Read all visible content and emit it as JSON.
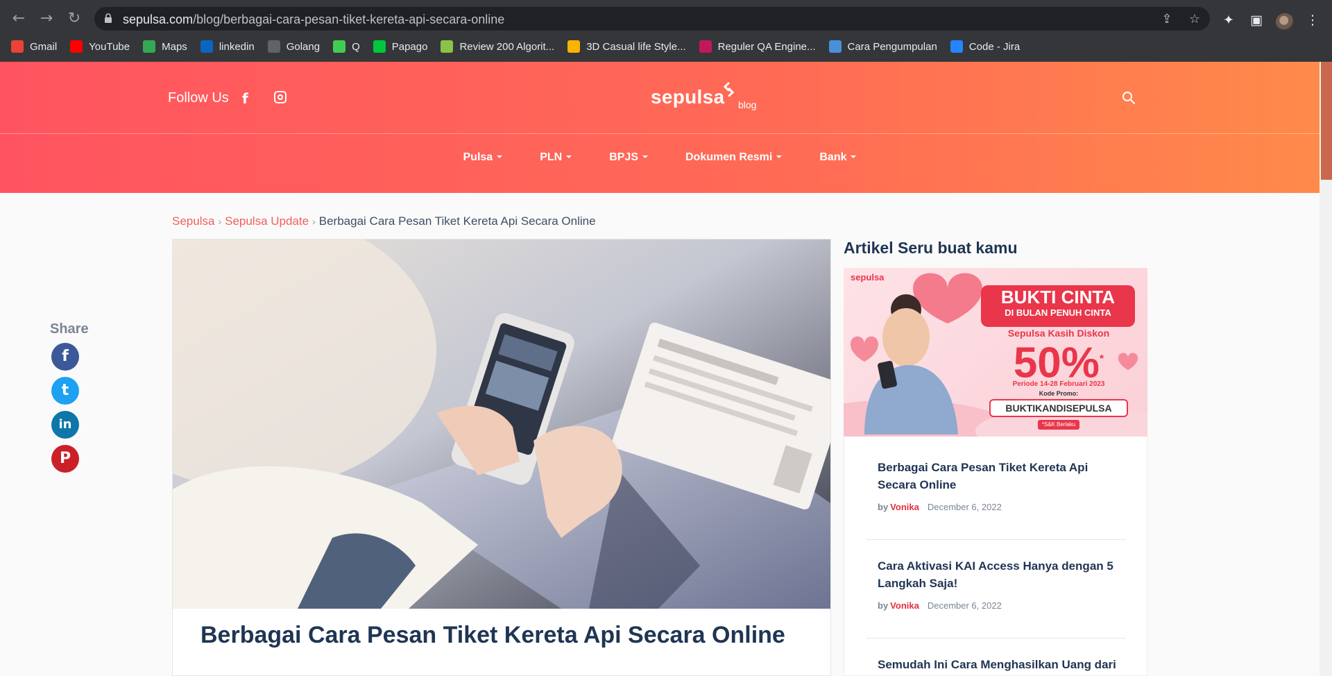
{
  "browser": {
    "url_host": "sepulsa.com",
    "url_path": "/blog/berbagai-cara-pesan-tiket-kereta-api-secara-online",
    "bookmarks": [
      {
        "label": "Gmail",
        "icon": "gmail-icon",
        "color": "#ea4335"
      },
      {
        "label": "YouTube",
        "icon": "youtube-icon",
        "color": "#ff0000"
      },
      {
        "label": "Maps",
        "icon": "maps-icon",
        "color": "#34a853"
      },
      {
        "label": "linkedin",
        "icon": "linkedin-icon",
        "color": "#0a66c2"
      },
      {
        "label": "Golang",
        "icon": "golang-icon",
        "color": "#5f6368"
      },
      {
        "label": "Q",
        "icon": "qt-icon",
        "color": "#41cd52"
      },
      {
        "label": "Papago",
        "icon": "papago-icon",
        "color": "#00c73c"
      },
      {
        "label": "Review 200 Algorit...",
        "icon": "pen-icon",
        "color": "#8bc34a"
      },
      {
        "label": "3D Casual life Style...",
        "icon": "o-icon",
        "color": "#f9b400"
      },
      {
        "label": "Reguler QA Engine...",
        "icon": "flask-icon",
        "color": "#c2185b"
      },
      {
        "label": "Cara Pengumpulan",
        "icon": "laptop-icon",
        "color": "#4a90d9"
      },
      {
        "label": "Code - Jira",
        "icon": "jira-icon",
        "color": "#2684ff"
      }
    ]
  },
  "header": {
    "follow_label": "Follow Us",
    "logo_text": "sepulsa",
    "logo_sub": "blog",
    "nav": [
      "Pulsa",
      "PLN",
      "BPJS",
      "Dokumen Resmi",
      "Bank"
    ]
  },
  "breadcrumb": {
    "home": "Sepulsa",
    "category": "Sepulsa Update",
    "current": "Berbagai Cara Pesan Tiket Kereta Api Secara Online",
    "separator": "›"
  },
  "share": {
    "label": "Share",
    "networks": [
      {
        "name": "facebook-share-button",
        "glyph": "f",
        "color": "#3b5998"
      },
      {
        "name": "twitter-share-button",
        "glyph": "t",
        "color": "#1da1f2"
      },
      {
        "name": "linkedin-share-button",
        "glyph": "in",
        "color": "#0e76a8"
      },
      {
        "name": "pinterest-share-button",
        "glyph": "P",
        "color": "#cb2027"
      }
    ]
  },
  "article": {
    "title": "Berbagai Cara Pesan Tiket Kereta Api Secara Online"
  },
  "sidebar": {
    "title": "Artikel Seru buat kamu",
    "promo": {
      "brand": "sepulsa",
      "headline": "BUKTI CINTA",
      "subheadline": "DI BULAN PENUH CINTA",
      "tagline": "Sepulsa Kasih Diskon",
      "discount": "50%",
      "asterisk": "*",
      "period": "Periode 14-28 Februari 2023",
      "code_label": "Kode Promo:",
      "code": "BUKTIKANDISEPULSA",
      "terms": "*S&K Berlaku"
    },
    "posts": [
      {
        "title": "Berbagai Cara Pesan Tiket Kereta Api Secara Online",
        "by": "by",
        "author": "Vonika",
        "date": "December 6, 2022"
      },
      {
        "title": "Cara Aktivasi KAI Access Hanya dengan 5 Langkah Saja!",
        "by": "by",
        "author": "Vonika",
        "date": "December 6, 2022"
      },
      {
        "title": "Semudah Ini Cara Menghasilkan Uang dari",
        "by": "",
        "author": "",
        "date": ""
      }
    ]
  }
}
